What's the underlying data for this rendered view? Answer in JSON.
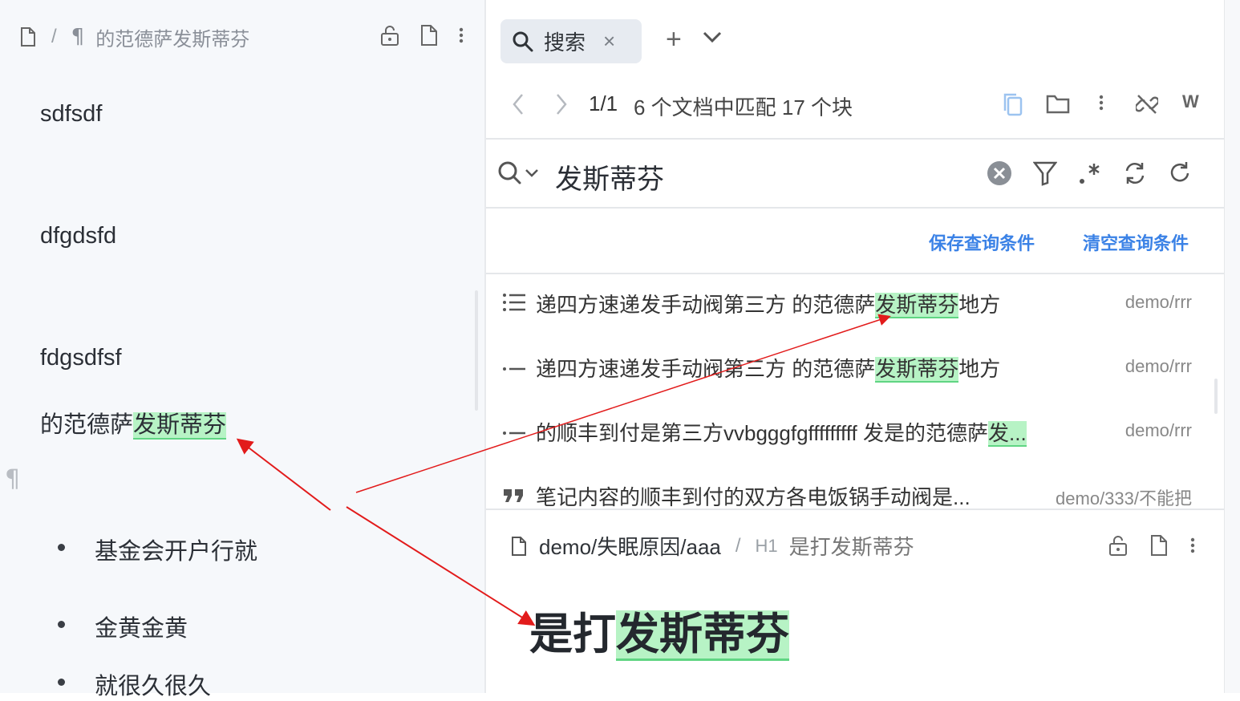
{
  "left": {
    "breadcrumb": {
      "separator": "/",
      "pilcrow": "¶",
      "title": "的范德萨发斯蒂芬"
    },
    "blocks": [
      "sdfsdf",
      "dfgdsfd",
      "fdgsdfsf"
    ],
    "highlight_block": {
      "prefix": "的范德萨",
      "match": "发斯蒂芬"
    },
    "gutter_pilcrow": "¶",
    "list_items": [
      "基金会开户行就",
      "金黄金黄",
      "就很久很久"
    ]
  },
  "tab": {
    "label": "搜索",
    "close": "×",
    "add": "+"
  },
  "nav": {
    "page": "1/1",
    "summary": "6 个文档中匹配 17 个块",
    "w_label": "W"
  },
  "search": {
    "query": "发斯蒂芬"
  },
  "links": {
    "save": "保存查询条件",
    "clear": "清空查询条件"
  },
  "results": [
    {
      "icon": "list-icon",
      "prefix": "递四方速递发手动阀第三方 的范德萨",
      "match": "发斯蒂芬",
      "suffix": "地方",
      "path": "demo/rrr"
    },
    {
      "icon": "list-item-icon",
      "prefix": "递四方速递发手动阀第三方 的范德萨",
      "match": "发斯蒂芬",
      "suffix": "地方",
      "path": "demo/rrr"
    },
    {
      "icon": "list-item-icon",
      "prefix": "的顺丰到付是第三方vvbgggfgfffffffff 发是的范德萨",
      "match": "发...",
      "suffix": "",
      "path": "demo/rrr"
    },
    {
      "icon": "quote-icon",
      "prefix": "笔记内容的顺丰到付的双方各电饭锅手动阀是...",
      "match": "",
      "suffix": "",
      "path": "demo/333/不能把"
    }
  ],
  "preview": {
    "doc_path": "demo/失眠原因/aaa",
    "separator": "/",
    "heading_tag": "H1",
    "heading_crumb": "是打发斯蒂芬",
    "heading_prefix": "是打",
    "heading_match": "发斯蒂芬"
  },
  "colors": {
    "highlight": "#b7f3c5",
    "link": "#3b82e6",
    "annotation_arrow": "#e21b1b"
  }
}
